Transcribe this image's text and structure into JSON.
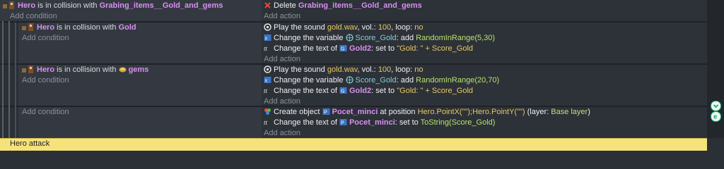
{
  "events": [
    {
      "conditions": [
        {
          "object": "Hero",
          "text": "is in collision with",
          "target": "Grabing_items__Gold_and_gems"
        }
      ],
      "add_condition": "Add condition",
      "actions": [
        {
          "icon": "delete-icon",
          "verb": "Delete",
          "object": "Grabing_items__Gold_and_gems"
        }
      ],
      "add_action": "Add action"
    },
    {
      "conditions": [
        {
          "object": "Hero",
          "text": "is in collision with",
          "target": "Gold"
        }
      ],
      "add_condition": "Add condition",
      "actions": [
        {
          "icon": "sound-icon",
          "a": "Play the sound",
          "b": "gold.wav",
          "c": ", vol.:",
          "d": "100",
          "e": ", loop:",
          "f": "no"
        },
        {
          "icon": "variable-icon",
          "a": "Change the variable",
          "b": "Score_Gold",
          "c": ": add",
          "d": "RandomInRange(5,30)"
        },
        {
          "icon": "text-icon",
          "a": "Change the text of",
          "b": "Gold2",
          "c": ": set to",
          "d": "\"Gold: \" + Score_Gold"
        }
      ],
      "add_action": "Add action"
    },
    {
      "conditions": [
        {
          "object": "Hero",
          "text": "is in collision with",
          "target": "gems"
        }
      ],
      "add_condition": "Add condition",
      "actions": [
        {
          "icon": "sound-icon",
          "a": "Play the sound",
          "b": "gold.wav",
          "c": ", vol.:",
          "d": "100",
          "e": ", loop:",
          "f": "no"
        },
        {
          "icon": "variable-icon",
          "a": "Change the variable",
          "b": "Score_Gold",
          "c": ": add",
          "d": "RandomInRange(20,70)"
        },
        {
          "icon": "text-icon",
          "a": "Change the text of",
          "b": "Gold2",
          "c": ": set to",
          "d": "\"Gold: \" + Score_Gold"
        }
      ],
      "add_action": "Add action"
    },
    {
      "conditions": [],
      "add_condition": "Add condition",
      "actions": [
        {
          "icon": "create-object-icon",
          "a": "Create object",
          "b": "Pocet_minci",
          "c": "at position",
          "d": "Hero.PointX(\"\");Hero.PointY(\"\")",
          "e": "(layer:",
          "f": "Base layer",
          "g": ")"
        },
        {
          "icon": "text-icon",
          "a": "Change the text of",
          "b": "Pocet_minci",
          "c": ": set to",
          "d": "ToString(Score_Gold)"
        }
      ],
      "add_action": "Add action"
    }
  ],
  "bottom_event": {
    "label": "Hero attack"
  }
}
